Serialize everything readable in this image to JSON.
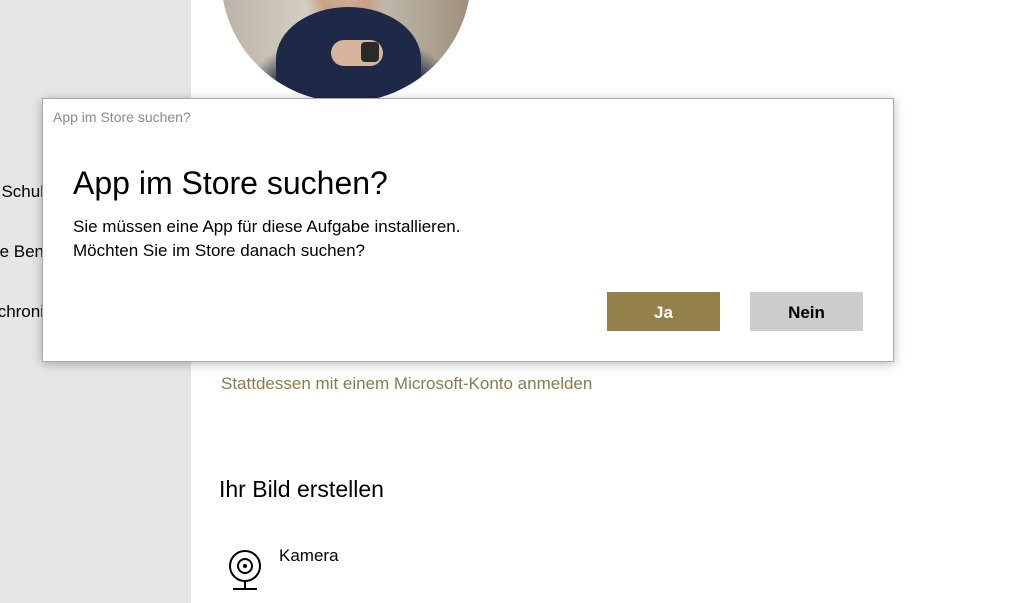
{
  "sidebar": {
    "items": [
      {
        "label": "Schul"
      },
      {
        "label": "e Ben"
      },
      {
        "label": "chroni"
      }
    ]
  },
  "main": {
    "partial_text": "",
    "microsoft_link": "Stattdessen mit einem Microsoft-Konto anmelden",
    "create_picture": {
      "title": "Ihr Bild erstellen",
      "camera_label": "Kamera"
    }
  },
  "dialog": {
    "caption": "App im Store suchen?",
    "title": "App im Store suchen?",
    "message_line1": "Sie müssen eine App für diese Aufgabe installieren.",
    "message_line2": "Möchten Sie im Store danach suchen?",
    "yes_label": "Ja",
    "no_label": "Nein"
  },
  "colors": {
    "accent": "#93804a",
    "link": "#8b7b4a",
    "secondary_button": "#cccccc",
    "sidebar_bg": "#e6e6e6"
  }
}
